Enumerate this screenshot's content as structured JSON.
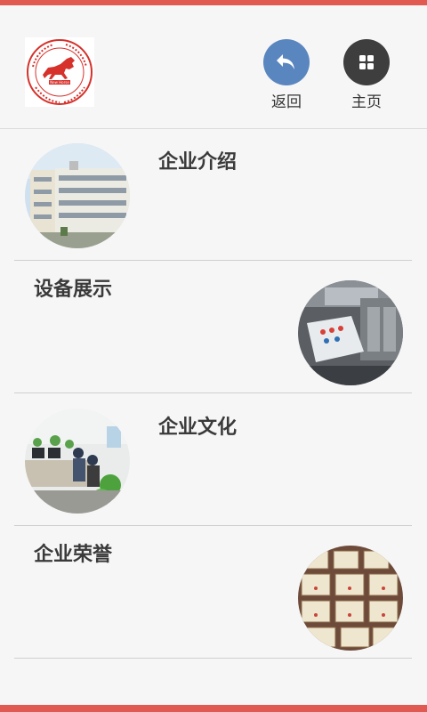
{
  "colors": {
    "accent_bar": "#e05a52",
    "back_button": "#5a86c0",
    "home_button": "#3e3e3e"
  },
  "logo": {
    "icon": "horse-logo-icon",
    "brand_text": "New Horse"
  },
  "header": {
    "back_label": "返回",
    "home_label": "主页",
    "back_icon": "return-arrow-icon",
    "home_icon": "grid-icon"
  },
  "menu": {
    "items": [
      {
        "label": "企业介绍",
        "image": "building-photo"
      },
      {
        "label": "设备展示",
        "image": "machine-photo"
      },
      {
        "label": "企业文化",
        "image": "office-photo"
      },
      {
        "label": "企业荣誉",
        "image": "certificates-photo"
      }
    ]
  }
}
